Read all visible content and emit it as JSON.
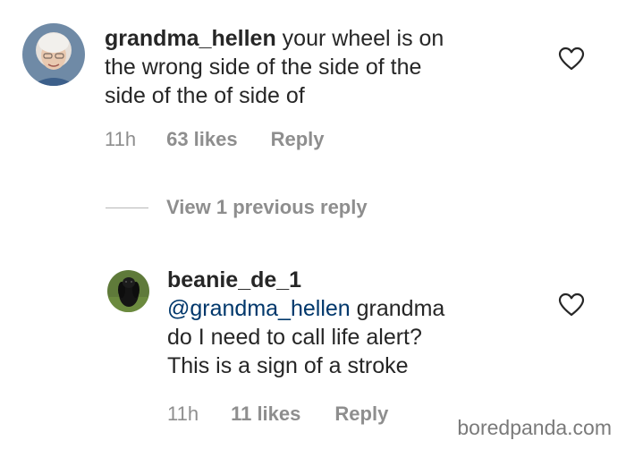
{
  "comment1": {
    "username": "grandma_hellen",
    "text_line1": " your wheel is on",
    "text_line2": "the wrong side of the side of the",
    "text_line3": "side of the of side of",
    "time": "11h",
    "likes": "63 likes",
    "reply": "Reply",
    "avatar_icon": "grandma-avatar",
    "like_icon": "heart-outline-icon"
  },
  "view_previous": {
    "label": "View 1 previous reply"
  },
  "comment2": {
    "username": "beanie_de_1",
    "mention": "@grandma_hellen",
    "text_line1": " grandma",
    "text_line2": "do I need to call life alert?",
    "text_line3": "This is a sign of a stroke",
    "time": "11h",
    "likes": "11 likes",
    "reply": "Reply",
    "avatar_icon": "dog-avatar",
    "like_icon": "heart-outline-icon"
  },
  "watermark": "boredpanda.com",
  "colors": {
    "text": "#262626",
    "meta": "#8e8e8e",
    "mention": "#00376b",
    "background": "#ffffff"
  }
}
